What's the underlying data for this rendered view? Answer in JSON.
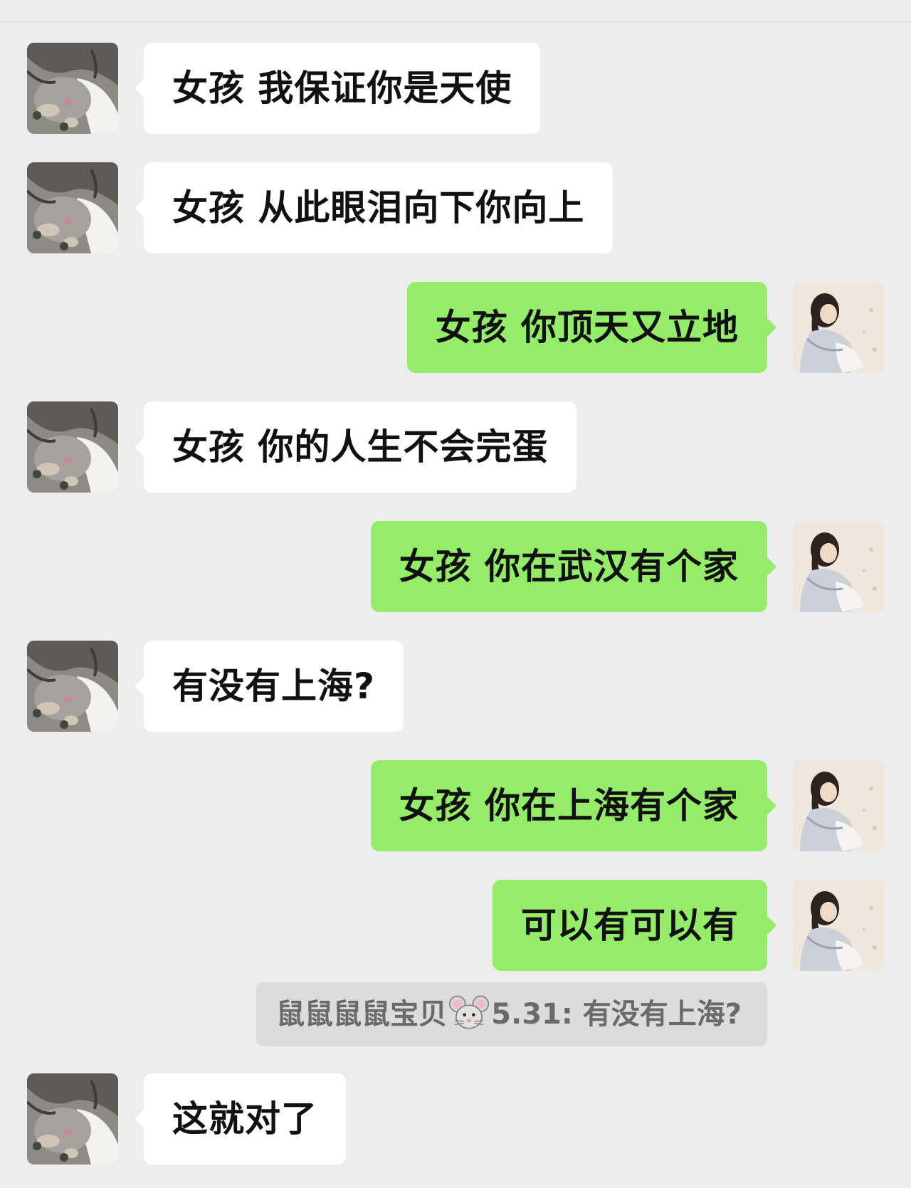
{
  "contact_avatar": "cat-avatar",
  "self_avatar": "girl-avatar",
  "colors": {
    "background": "#ededed",
    "incoming_bubble": "#ffffff",
    "outgoing_bubble": "#95ec69",
    "quote_bg": "#dcdcdc",
    "quote_text": "#6a6a6a"
  },
  "messages": [
    {
      "side": "incoming",
      "text": "女孩 我保证你是天使"
    },
    {
      "side": "incoming",
      "text": "女孩 从此眼泪向下你向上"
    },
    {
      "side": "outgoing",
      "text": "女孩 你顶天又立地"
    },
    {
      "side": "incoming",
      "text": "女孩 你的人生不会完蛋"
    },
    {
      "side": "outgoing",
      "text": "女孩 你在武汉有个家"
    },
    {
      "side": "incoming",
      "text": "有没有上海?"
    },
    {
      "side": "outgoing",
      "text": "女孩 你在上海有个家"
    },
    {
      "side": "outgoing",
      "text": "可以有可以有"
    },
    {
      "side": "incoming",
      "text": "这就对了"
    }
  ],
  "quote": {
    "sender": "鼠鼠鼠鼠宝贝",
    "emoji": "mouse-face",
    "text": "5.31: 有没有上海?"
  }
}
